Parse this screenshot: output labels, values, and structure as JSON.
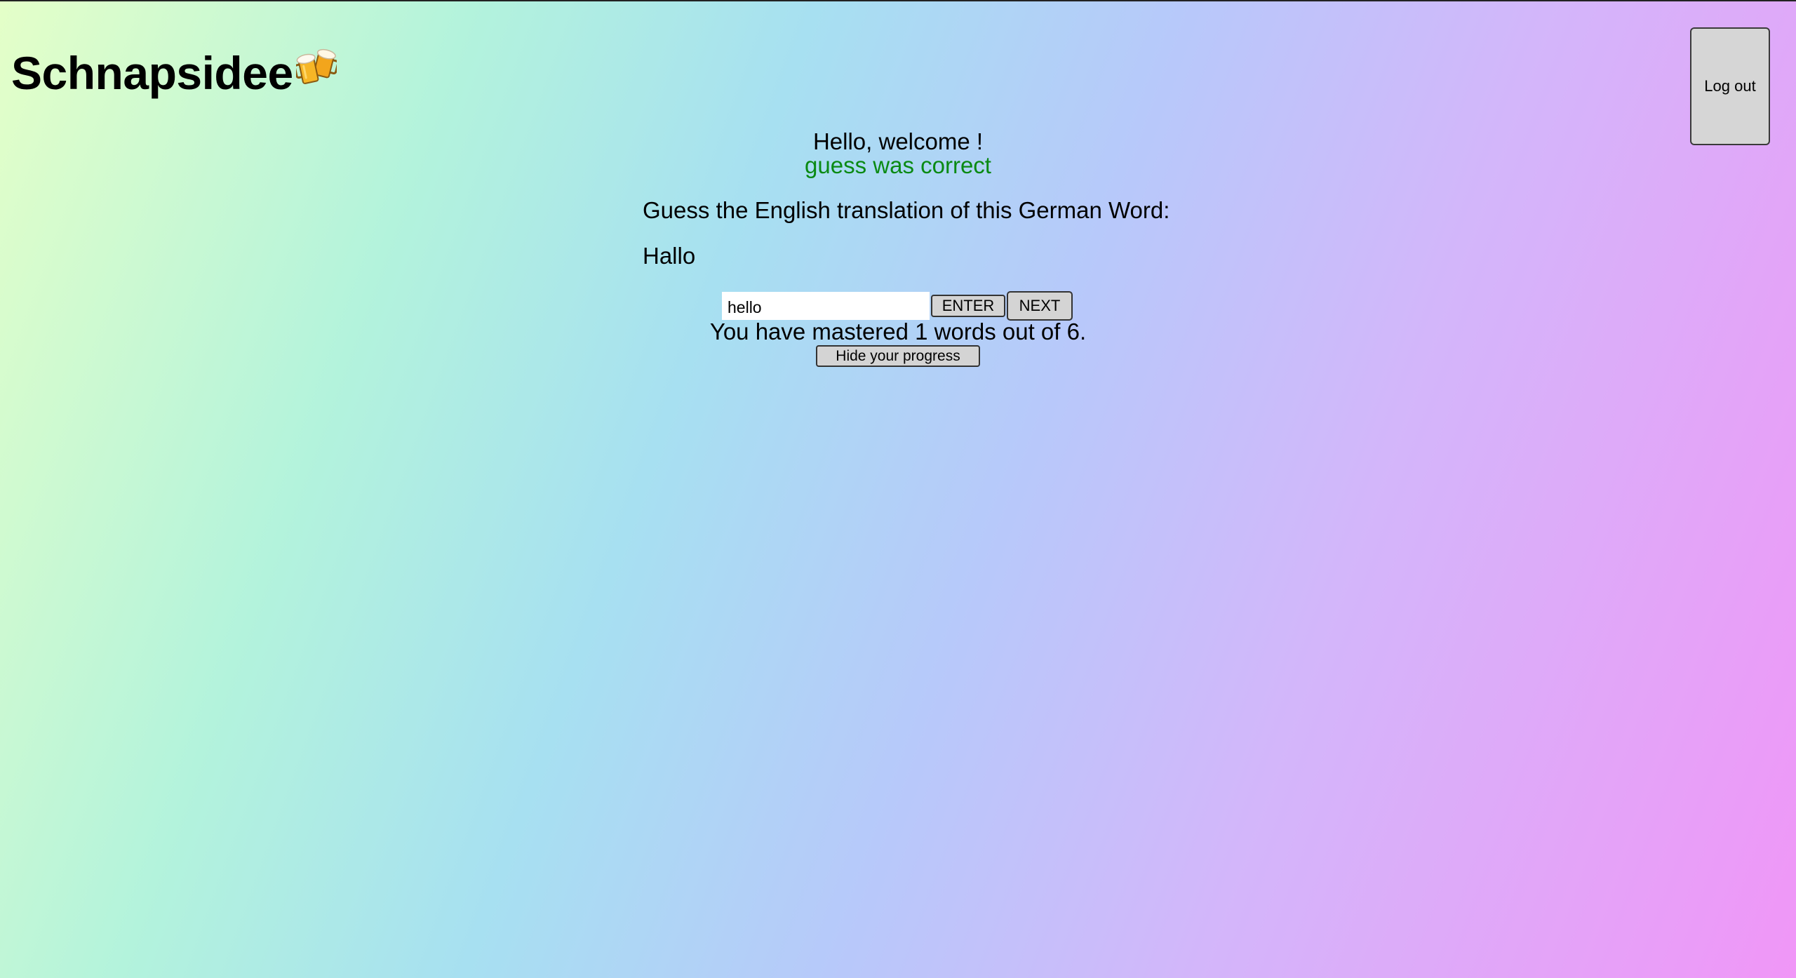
{
  "header": {
    "app_name": "Schnapsidee",
    "logo_icon": "beer-mugs-icon",
    "logout_label": "Log out"
  },
  "game": {
    "welcome_text": "Hello, welcome !",
    "status_text": "guess was correct",
    "status_color": "#0a8a13",
    "prompt_text": "Guess the English translation of this German Word:",
    "german_word": "Hallo",
    "answer_value": "hello",
    "answer_placeholder": "",
    "enter_label": "ENTER",
    "next_label": "NEXT"
  },
  "progress": {
    "text": "You have mastered 1 words out of 6.",
    "mastered": 1,
    "total": 6,
    "toggle_label": "Hide your progress"
  }
}
